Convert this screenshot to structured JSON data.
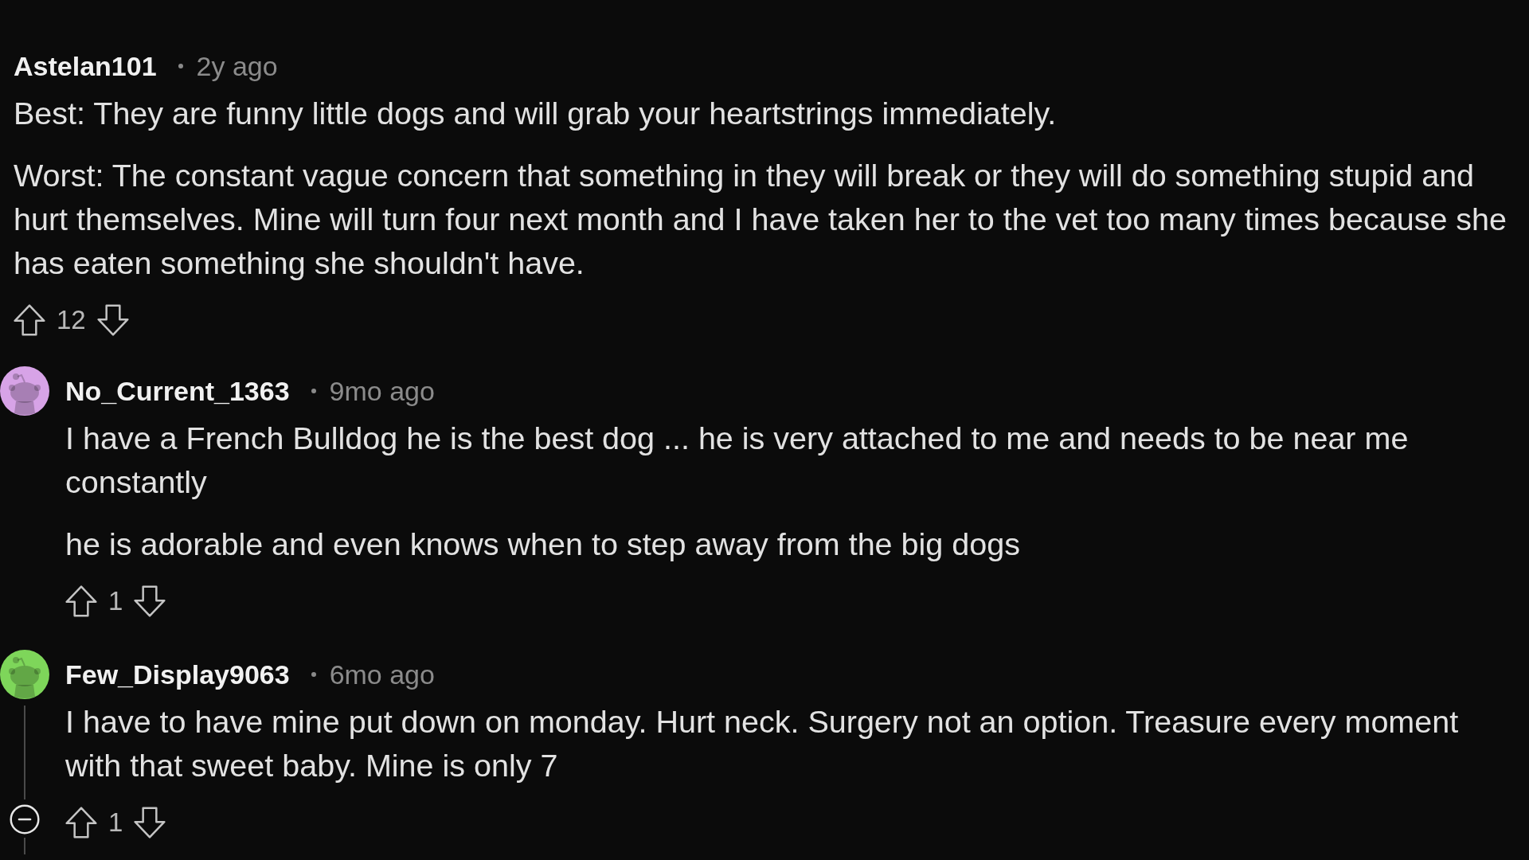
{
  "comments": [
    {
      "author": "Astelan101",
      "time": "2y ago",
      "paragraphs": [
        "Best: They are funny little dogs and will grab your heartstrings immediately.",
        "Worst: The constant vague concern that something in they will break or they will do something stupid and hurt themselves. Mine will turn four next month and I have taken her to the vet too many times because she has eaten something she shouldn't have."
      ],
      "score": "12",
      "replies": [
        {
          "author": "No_Current_1363",
          "time": "9mo ago",
          "avatar": {
            "color": "#d7a3e7"
          },
          "paragraphs": [
            "I have a French Bulldog he is the best dog ... he is very attached to me and needs to be near me constantly",
            "he is adorable and even knows when to step away from the big dogs"
          ],
          "score": "1",
          "collapsible": false
        },
        {
          "author": "Few_Display9063",
          "time": "6mo ago",
          "avatar": {
            "color": "#7ed65a"
          },
          "paragraphs": [
            "I have to have mine put down on monday. Hurt neck. Surgery not an option. Treasure every moment with that sweet baby. Mine is only 7"
          ],
          "score": "1",
          "collapsible": true
        }
      ]
    }
  ]
}
